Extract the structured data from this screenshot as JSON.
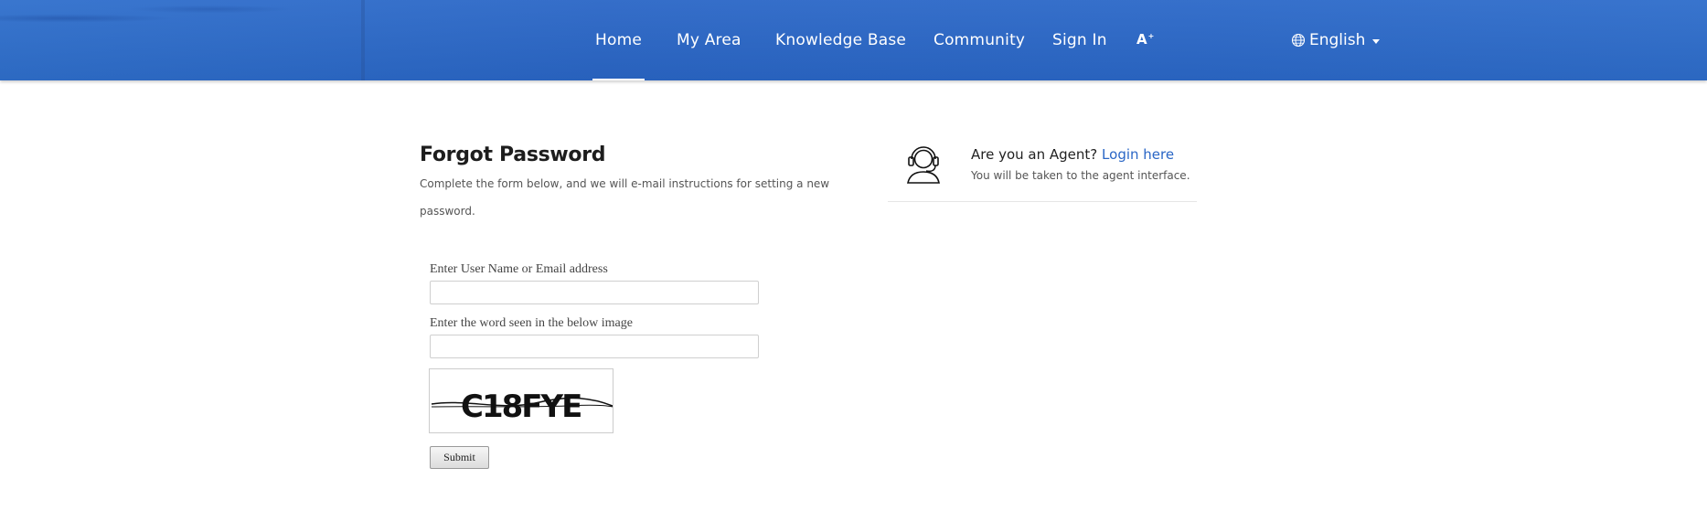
{
  "header": {
    "nav": [
      {
        "label": "Home",
        "active": true
      },
      {
        "label": "My Area"
      },
      {
        "label": "Knowledge Base"
      },
      {
        "label": "Community"
      },
      {
        "label": "Sign In"
      }
    ],
    "font_size_icon": "A",
    "language": {
      "label": "English",
      "icon": "globe-icon"
    }
  },
  "form": {
    "title": "Forgot Password",
    "description": "Complete the form below, and we will e-mail instructions for setting a new password.",
    "username_label": "Enter User Name or Email address",
    "username_value": "",
    "captcha_label": "Enter the word seen in the below image",
    "captcha_value": "",
    "captcha_text": "C18FYE",
    "submit_label": "Submit"
  },
  "agent": {
    "question": "Are you an Agent?",
    "link": "Login here",
    "subtext": "You will be taken to the agent interface.",
    "icon": "headset-agent-icon"
  },
  "colors": {
    "header_bg": "#2b68c8",
    "link": "#2a66c6"
  }
}
